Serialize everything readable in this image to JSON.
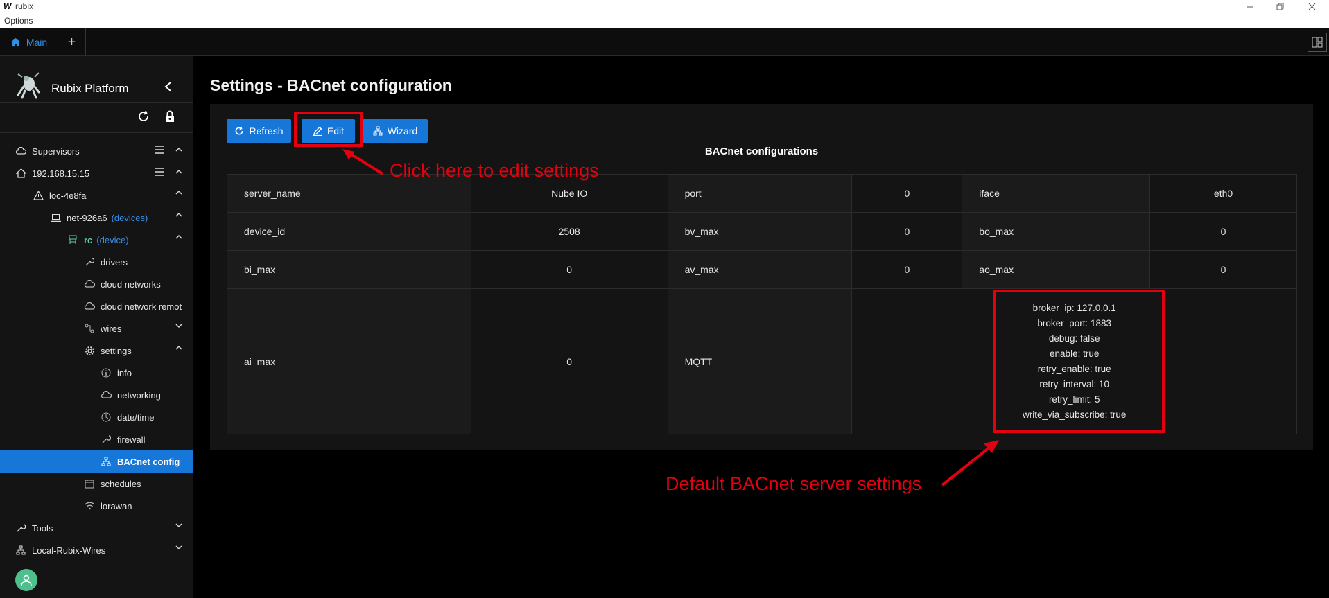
{
  "window": {
    "logo": "W",
    "title": "rubix",
    "menu": "Options"
  },
  "tabs": {
    "main_label": "Main",
    "add_label": "+"
  },
  "sidebar": {
    "brand": "Rubix Platform",
    "items": {
      "supervisors": "Supervisors",
      "host": "192.168.15.15",
      "location": "loc-4e8fa",
      "network": "net-926a6",
      "network_tag": "(devices)",
      "device": "rc",
      "device_tag": "(device)",
      "drivers": "drivers",
      "cloud_networks": "cloud networks",
      "cloud_network_remote": "cloud network remot",
      "wires": "wires",
      "settings": "settings",
      "info": "info",
      "networking": "networking",
      "datetime": "date/time",
      "firewall": "firewall",
      "bacnet_config": "BACnet config",
      "schedules": "schedules",
      "lorawan": "lorawan",
      "tools": "Tools",
      "local_wires": "Local-Rubix-Wires"
    }
  },
  "main": {
    "title": "Settings - BACnet configuration",
    "buttons": {
      "refresh": "Refresh",
      "edit": "Edit",
      "wizard": "Wizard"
    },
    "table_title": "BACnet configurations",
    "rows": [
      [
        {
          "k": "server_name",
          "v": "Nube IO"
        },
        {
          "k": "port",
          "v": "0"
        },
        {
          "k": "iface",
          "v": "eth0"
        }
      ],
      [
        {
          "k": "device_id",
          "v": "2508"
        },
        {
          "k": "bv_max",
          "v": "0"
        },
        {
          "k": "bo_max",
          "v": "0"
        }
      ],
      [
        {
          "k": "bi_max",
          "v": "0"
        },
        {
          "k": "av_max",
          "v": "0"
        },
        {
          "k": "ao_max",
          "v": "0"
        }
      ]
    ],
    "last_row": {
      "k": "ai_max",
      "v": "0",
      "mqtt_label": "MQTT"
    },
    "mqtt": [
      "broker_ip: 127.0.0.1",
      "broker_port: 1883",
      "debug: false",
      "enable: true",
      "retry_enable: true",
      "retry_interval: 10",
      "retry_limit: 5",
      "write_via_subscribe: true"
    ]
  },
  "annotations": {
    "edit_hint": "Click here to edit settings",
    "default_hint": "Default BACnet server settings",
    "color": "#e3000f"
  },
  "colors": {
    "accent": "#1677d8",
    "background": "#000000",
    "panel": "#141414",
    "device_green": "#5fd39b"
  },
  "icons": {
    "home": "home-icon",
    "refresh": "refresh-icon",
    "lock": "lock-icon",
    "edit": "pencil-icon",
    "wizard": "sitemap-icon"
  }
}
